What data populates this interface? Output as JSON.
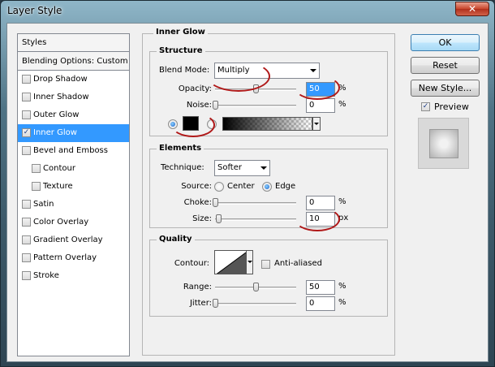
{
  "window": {
    "title": "Layer Style",
    "close_glyph": "✕"
  },
  "styles_panel": {
    "header": "Styles",
    "blending": "Blending Options: Custom",
    "items": [
      {
        "label": "Drop Shadow",
        "checked": false
      },
      {
        "label": "Inner Shadow",
        "checked": false
      },
      {
        "label": "Outer Glow",
        "checked": false
      },
      {
        "label": "Inner Glow",
        "checked": true,
        "selected": true
      },
      {
        "label": "Bevel and Emboss",
        "checked": false
      },
      {
        "label": "Contour",
        "checked": false,
        "sub": true
      },
      {
        "label": "Texture",
        "checked": false,
        "sub": true
      },
      {
        "label": "Satin",
        "checked": false
      },
      {
        "label": "Color Overlay",
        "checked": false
      },
      {
        "label": "Gradient Overlay",
        "checked": false
      },
      {
        "label": "Pattern Overlay",
        "checked": false
      },
      {
        "label": "Stroke",
        "checked": false
      }
    ]
  },
  "inner_glow": {
    "title": "Inner Glow",
    "structure": {
      "title": "Structure",
      "blend_mode_label": "Blend Mode:",
      "blend_mode_value": "Multiply",
      "opacity_label": "Opacity:",
      "opacity_value": "50",
      "opacity_unit": "%",
      "opacity_fraction": 0.5,
      "noise_label": "Noise:",
      "noise_value": "0",
      "noise_unit": "%",
      "noise_fraction": 0.0,
      "glow_color": "#000000"
    },
    "elements": {
      "title": "Elements",
      "technique_label": "Technique:",
      "technique_value": "Softer",
      "source_label": "Source:",
      "source_center": "Center",
      "source_edge": "Edge",
      "choke_label": "Choke:",
      "choke_value": "0",
      "choke_unit": "%",
      "choke_fraction": 0.0,
      "size_label": "Size:",
      "size_value": "10",
      "size_unit": "px",
      "size_fraction": 0.04
    },
    "quality": {
      "title": "Quality",
      "contour_label": "Contour:",
      "anti_aliased_label": "Anti-aliased",
      "range_label": "Range:",
      "range_value": "50",
      "range_unit": "%",
      "range_fraction": 0.5,
      "jitter_label": "Jitter:",
      "jitter_value": "0",
      "jitter_unit": "%",
      "jitter_fraction": 0.0
    }
  },
  "buttons": {
    "ok": "OK",
    "reset": "Reset",
    "new_style": "New Style...",
    "preview": "Preview"
  },
  "colors": {
    "selection": "#3399ff",
    "annotation": "#b01818"
  }
}
